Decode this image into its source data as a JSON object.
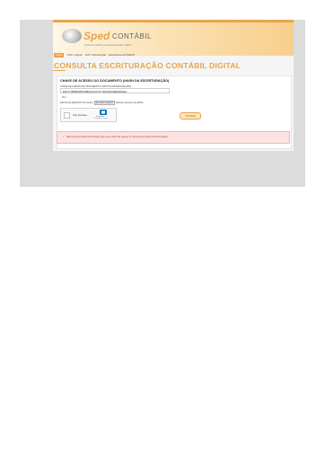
{
  "header": {
    "logo_main": "Sped",
    "logo_secondary": "CONTÁBIL",
    "logo_tagline": "Sistema Público de Escrituração Digital"
  },
  "tabs": [
    {
      "label": "Início"
    },
    {
      "label": "FAP e Ajuda"
    },
    {
      "label": "ECF Substituição"
    },
    {
      "label": "Estatísticas ECD/ECF"
    }
  ],
  "page_title": "CONSULTA ESCRITURAÇÃO CONTÁBIL DIGITAL",
  "form": {
    "section_title": "CHAVE DE ACESSO DO DOCUMENTO (HASH DA ESCRITURAÇÃO)",
    "key_label": "CHAVE DE ACESSO DO DOCUMENTO (HASH DA ESCRITURAÇÃO):",
    "key_value": "E3F7C7B6B0086783BF8C1CF7F7780A02F06EDE4DE3",
    "or_label": "OU",
    "file_label": "ESCOLHA ARQUIVO do recibo:",
    "file_button": "Escolher arquivo",
    "file_status": "Nenhum arquivo escolhido",
    "captcha_label": "Sou humano",
    "captcha_brand": "hCaptcha",
    "captcha_links": "Privacidade - Termos",
    "filter_button": "FILTRAR"
  },
  "alert": {
    "bullet": "•",
    "message": "Não foi encontrada escrituração para essa chave de acesso do documento (hash da escrituração)."
  },
  "colors": {
    "accent": "#e8a44a",
    "alert_bg": "#fbe3e4",
    "alert_text": "#c0392b"
  }
}
